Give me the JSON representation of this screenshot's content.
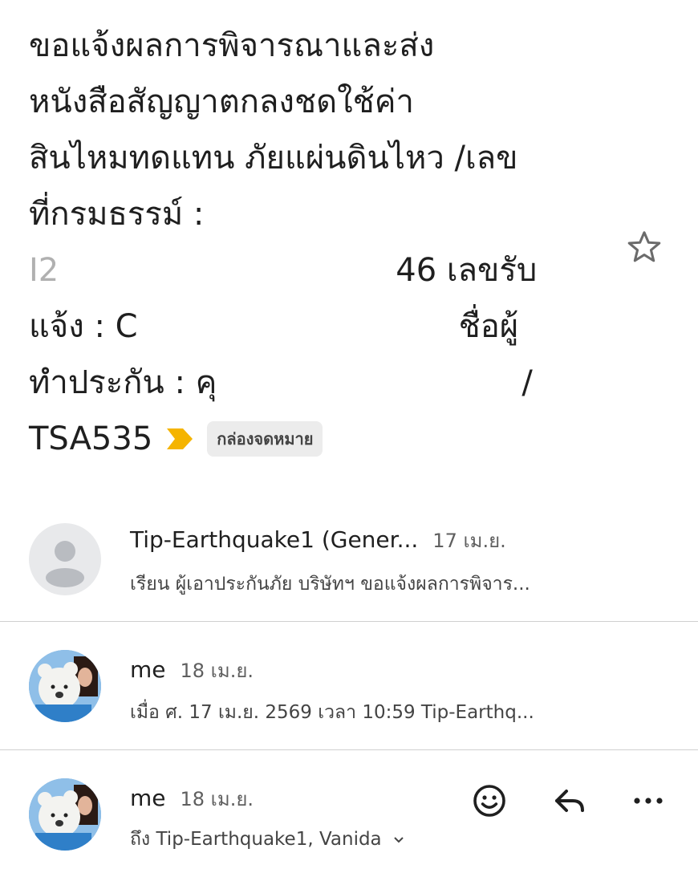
{
  "subject": {
    "line1": "ขอแจ้งผลการพิจารณาและส่ง",
    "line2": "หนังสือสัญญาตกลงชดใช้ค่า",
    "line3": "สินไหมทดแทน ภัยแผ่นดินไหว /เลข",
    "line4": "ที่กรมธรรม์ :",
    "line5_a": "I2",
    "line5_b": "46 เลขรับ",
    "line6_a": "แจ้ง : C",
    "line6_b": "ชื่อผู้",
    "line7_a": "ทำประกัน : คุ",
    "line7_b": "/",
    "line8": "TSA535"
  },
  "label_chip": "กล่องจดหมาย",
  "colors": {
    "label_arrow": "#f5b400",
    "accent_text": "#1f1f1f"
  },
  "messages": [
    {
      "sender": "Tip-Earthquake1 (Gener...",
      "date": "17 เม.ย.",
      "snippet": "เรียน ผู้เอาประกันภัย บริษัทฯ ขอแจ้งผลการพิจาร...",
      "avatar": "default-person-icon"
    },
    {
      "sender": "me",
      "date": "18 เม.ย.",
      "snippet": "เมื่อ ศ. 17 เม.ย. 2569 เวลา 10:59 Tip-Earthq...",
      "avatar": "profile-photo"
    },
    {
      "sender": "me",
      "date": "18 เม.ย.",
      "recipients": "ถึง Tip-Earthquake1, Vanida",
      "avatar": "profile-photo"
    }
  ],
  "icons": [
    "star-icon",
    "important-arrow-icon",
    "emoji-icon",
    "reply-icon",
    "more-icon",
    "chevron-down-icon"
  ]
}
